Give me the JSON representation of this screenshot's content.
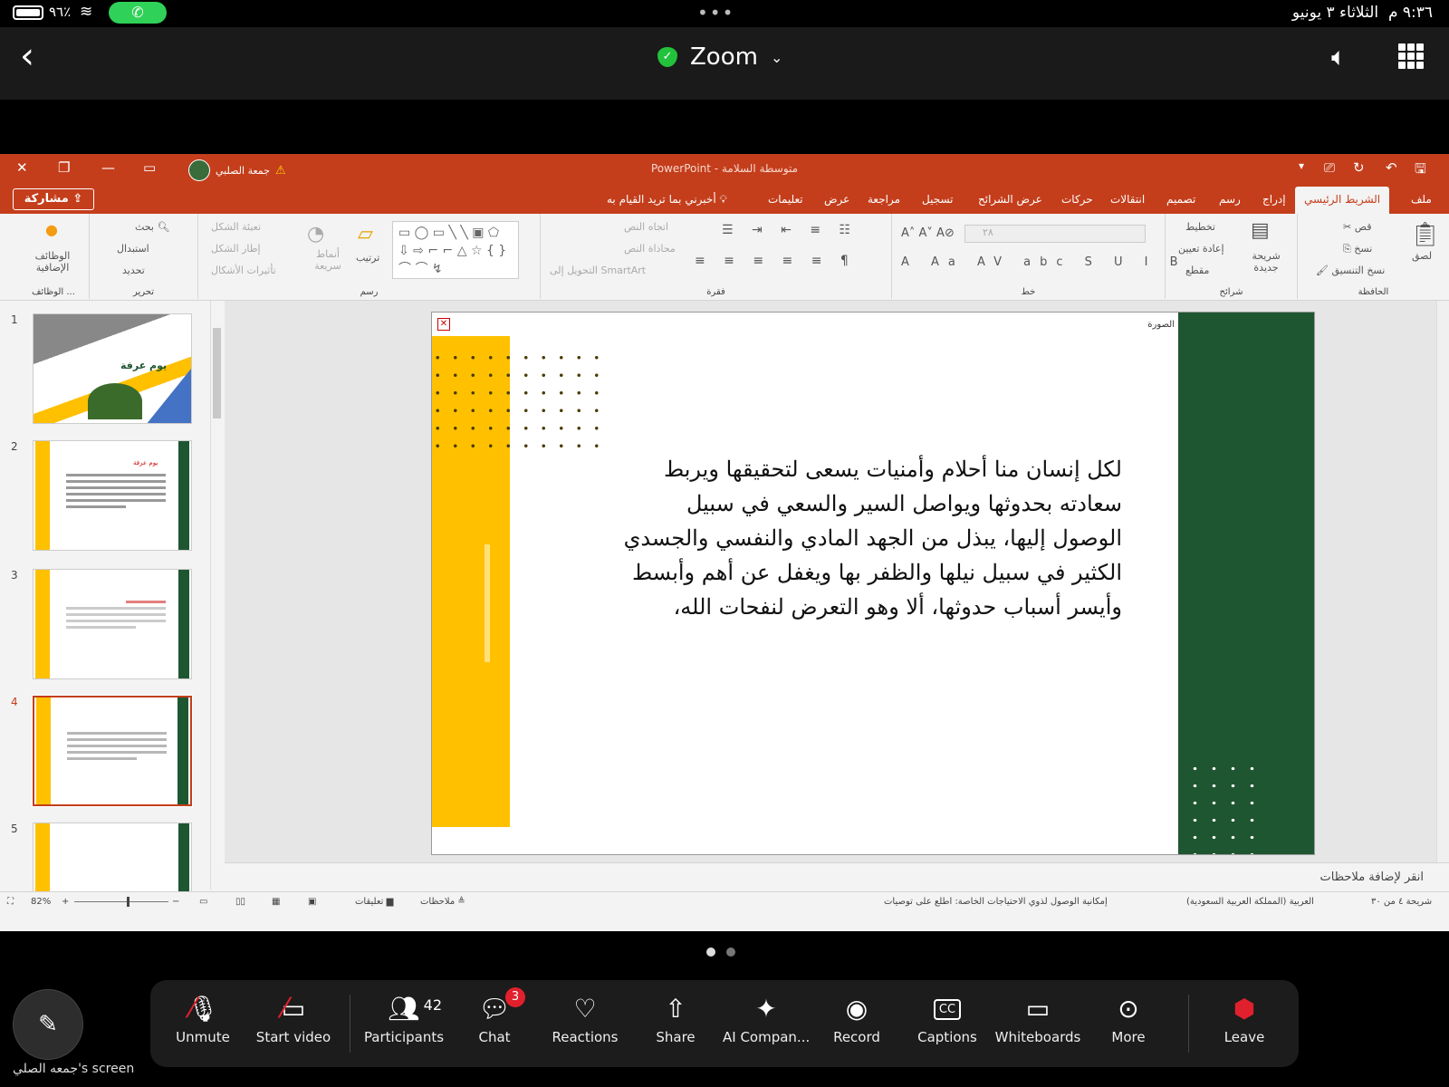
{
  "status_bar": {
    "time": "٩:٣٦ م",
    "date": "الثلاثاء ٣ يونيو",
    "battery": "٩٦٪"
  },
  "zoom_header": {
    "title": "Zoom"
  },
  "ppt": {
    "title_bar": {
      "document": "متوسطة السلامة",
      "app": "PowerPoint",
      "user": "جمعة الصلبي"
    },
    "tabs": [
      "ملف",
      "الشريط الرئيسي",
      "إدراج",
      "رسم",
      "تصميم",
      "انتقالات",
      "حركات",
      "عرض الشرائح",
      "تسجيل",
      "مراجعة",
      "عرض",
      "تعليمات"
    ],
    "tell_me": "أخبرني بما تريد القيام به",
    "share_button": "مشاركة",
    "ribbon": {
      "clipboard": {
        "label": "الحافظة",
        "paste": "لصق",
        "cut": "قص",
        "copy": "نسخ",
        "format_painter": "نسخ التنسيق"
      },
      "slides": {
        "label": "شرائح",
        "new_slide": "شريحة جديدة",
        "layout": "تخطيط",
        "reset": "إعادة تعيين",
        "section": "مقطع"
      },
      "font": {
        "label": "خط",
        "size": "٢٨"
      },
      "paragraph": {
        "label": "فقرة",
        "text_direction": "اتجاه النص",
        "align_text": "محاذاة النص",
        "smartart": "التحويل إلى SmartArt"
      },
      "drawing": {
        "label": "رسم",
        "arrange": "ترتيب",
        "quick_styles": "أنماط سريعة",
        "shape_fill": "تعبئة الشكل",
        "shape_outline": "إطار الشكل",
        "shape_effects": "تأثيرات الأشكال"
      },
      "editing": {
        "label": "تحرير",
        "find": "بحث",
        "replace": "استبدال",
        "select": "تحديد"
      },
      "addins": {
        "label": "الوظائف ...",
        "button": "الوظائف الإضافية"
      }
    },
    "thumbnails": [
      {
        "number": "1",
        "title": "يوم عرفة"
      },
      {
        "number": "2",
        "title": "يوم عرفة"
      },
      {
        "number": "3",
        "title": ""
      },
      {
        "number": "4",
        "title": ""
      },
      {
        "number": "5",
        "title": ""
      }
    ],
    "slide": {
      "image_label": "الصورة",
      "lines": [
        "لكل إنسان منا أحلام وأمنيات يسعى لتحقيقها ويربط",
        "سعادته بحدوثها ويواصل السير والسعي في سبيل",
        "الوصول إليها، يبذل من الجهد المادي والنفسي والجسدي",
        "الكثير في سبيل نيلها والظفر بها ويغفل عن أهم وأبسط",
        "وأيسر أسباب حدوثها، ألا وهو التعرض لنفحات الله،"
      ]
    },
    "notes_placeholder": "انقر لإضافة ملاحظات",
    "status": {
      "slide_info": "شريحة ٤ من ٣٠",
      "language": "العربية (المملكة العربية السعودية)",
      "accessibility": "إمكانية الوصول لذوي الاحتياجات الخاصة: اطلع على توصيات",
      "notes": "ملاحظات",
      "comments": "تعليقات",
      "zoom": "82%"
    }
  },
  "presenter_label": "جمعه الصلي's screen",
  "toolbar": {
    "unmute": "Unmute",
    "start_video": "Start video",
    "participants": "Participants",
    "participants_count": "42",
    "chat": "Chat",
    "chat_badge": "3",
    "reactions": "Reactions",
    "share": "Share",
    "ai_companion": "AI Compan...",
    "record": "Record",
    "captions": "Captions",
    "whiteboards": "Whiteboards",
    "more": "More",
    "leave": "Leave"
  },
  "colors": {
    "ppt_accent": "#c43e1c",
    "slide_yellow": "#ffc000",
    "slide_green": "#1e5631",
    "leave_red": "#e0212d"
  }
}
